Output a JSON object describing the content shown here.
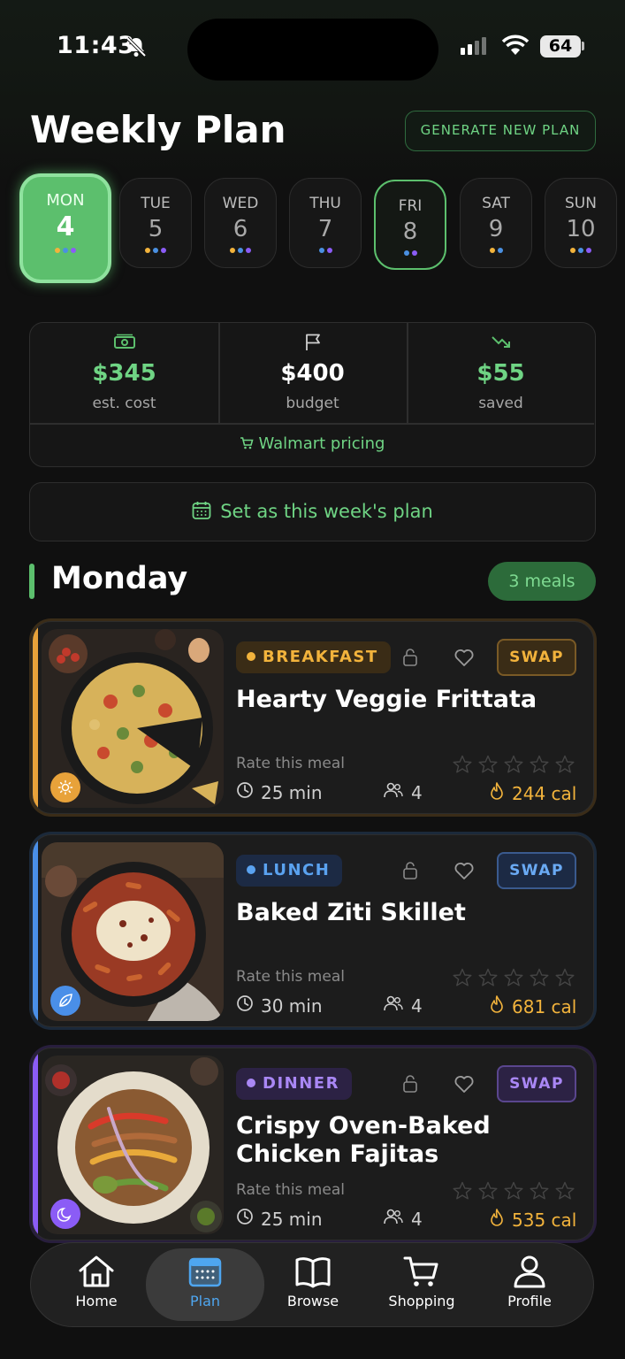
{
  "status_bar": {
    "time": "11:43",
    "battery": "64"
  },
  "header": {
    "title": "Weekly Plan",
    "generate_label": "GENERATE NEW PLAN"
  },
  "days": [
    {
      "name": "MON",
      "num": "4",
      "dots": [
        "#f2b33c",
        "#4a90e2",
        "#8b5cf6"
      ],
      "state": "active"
    },
    {
      "name": "TUE",
      "num": "5",
      "dots": [
        "#f2b33c",
        "#4a90e2",
        "#8b5cf6"
      ],
      "state": "normal"
    },
    {
      "name": "WED",
      "num": "6",
      "dots": [
        "#f2b33c",
        "#4a90e2",
        "#8b5cf6"
      ],
      "state": "normal"
    },
    {
      "name": "THU",
      "num": "7",
      "dots": [
        "#4a90e2",
        "#8b5cf6"
      ],
      "state": "normal"
    },
    {
      "name": "FRI",
      "num": "8",
      "dots": [
        "#4a90e2",
        "#8b5cf6"
      ],
      "state": "today"
    },
    {
      "name": "SAT",
      "num": "9",
      "dots": [
        "#f2b33c",
        "#4a90e2"
      ],
      "state": "normal"
    },
    {
      "name": "SUN",
      "num": "10",
      "dots": [
        "#f2b33c",
        "#4a90e2",
        "#8b5cf6"
      ],
      "state": "normal"
    }
  ],
  "stats": {
    "cost": {
      "value": "$345",
      "label": "est. cost",
      "icon": "cash-icon"
    },
    "budget": {
      "value": "$400",
      "label": "budget",
      "icon": "flag-icon"
    },
    "saved": {
      "value": "$55",
      "label": "saved",
      "icon": "trending-down-icon"
    },
    "pricing_label": "Walmart pricing"
  },
  "set_plan_label": "Set as this week's plan",
  "day_section": {
    "title": "Monday",
    "meals_badge": "3 meals"
  },
  "meals": [
    {
      "type": "BREAKFAST",
      "title": "Hearty Veggie Frittata",
      "rate_label": "Rate this meal",
      "time": "25 min",
      "servings": "4",
      "calories": "244 cal",
      "swap_label": "SWAP",
      "accent": "#e8a23a",
      "icon": "sun-icon"
    },
    {
      "type": "LUNCH",
      "title": "Baked Ziti Skillet",
      "rate_label": "Rate this meal",
      "time": "30 min",
      "servings": "4",
      "calories": "681 cal",
      "swap_label": "SWAP",
      "accent": "#4a8fe8",
      "icon": "leaf-icon"
    },
    {
      "type": "DINNER",
      "title": "Crispy Oven-Baked Chicken Fajitas",
      "rate_label": "Rate this meal",
      "time": "25 min",
      "servings": "4",
      "calories": "535 cal",
      "swap_label": "SWAP",
      "accent": "#8b5cf6",
      "icon": "moon-icon"
    }
  ],
  "tabbar": {
    "home": "Home",
    "plan": "Plan",
    "browse": "Browse",
    "shopping": "Shopping",
    "profile": "Profile",
    "active": "plan"
  }
}
